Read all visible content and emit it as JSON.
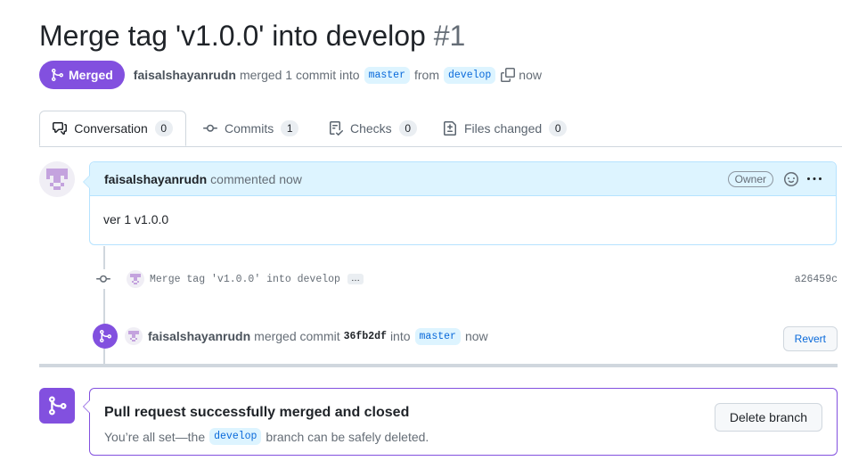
{
  "pr": {
    "title": "Merge tag 'v1.0.0' into develop",
    "number": "#1",
    "state_label": "Merged",
    "author": "faisalshayanrudn",
    "merged_text": "merged 1 commit into",
    "base_branch": "master",
    "from_text": "from",
    "head_branch": "develop",
    "time": "now"
  },
  "tabs": [
    {
      "label": "Conversation",
      "count": "0",
      "icon": "comment-discussion-icon",
      "active": true
    },
    {
      "label": "Commits",
      "count": "1",
      "icon": "git-commit-icon"
    },
    {
      "label": "Checks",
      "count": "0",
      "icon": "checklist-icon"
    },
    {
      "label": "Files changed",
      "count": "0",
      "icon": "file-diff-icon"
    }
  ],
  "comment": {
    "author": "faisalshayanrudn",
    "action": "commented now",
    "role_badge": "Owner",
    "body": "ver 1 v1.0.0"
  },
  "commit": {
    "message": "Merge tag 'v1.0.0' into develop",
    "more": "…",
    "sha": "a26459c"
  },
  "merge_event": {
    "author": "faisalshayanrudn",
    "text": "merged commit",
    "sha": "36fb2df",
    "into_text": "into",
    "branch": "master",
    "time": "now",
    "revert_label": "Revert"
  },
  "merge_box": {
    "title": "Pull request successfully merged and closed",
    "sub_prefix": "You’re all set—the",
    "branch": "develop",
    "sub_suffix": "branch can be safely deleted.",
    "delete_label": "Delete branch"
  },
  "colors": {
    "merged": "#8250df",
    "link": "#0969da",
    "branch_bg": "#ddf4ff",
    "comment_header_bg": "#ddf4ff",
    "border": "#d0d7de"
  }
}
